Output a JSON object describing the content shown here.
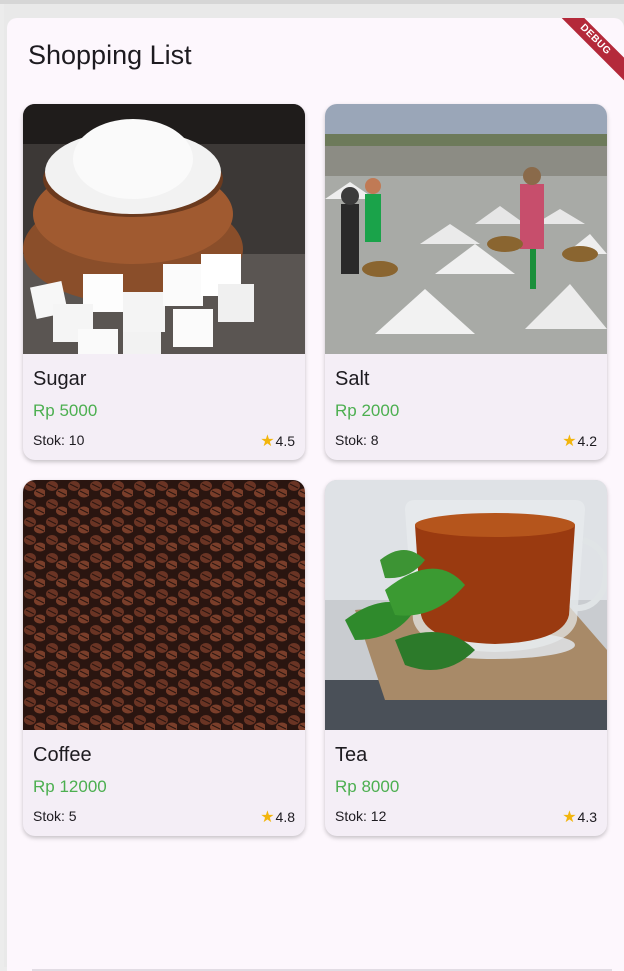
{
  "app": {
    "title": "Shopping List",
    "debug_banner": "DEBUG"
  },
  "items": [
    {
      "name": "Sugar",
      "price": "Rp 5000",
      "stock": "Stok: 10",
      "rating": "4.5",
      "image": "sugar-image"
    },
    {
      "name": "Salt",
      "price": "Rp 2000",
      "stock": "Stok: 8",
      "rating": "4.2",
      "image": "salt-image"
    },
    {
      "name": "Coffee",
      "price": "Rp 12000",
      "stock": "Stok: 5",
      "rating": "4.8",
      "image": "coffee-image"
    },
    {
      "name": "Tea",
      "price": "Rp 8000",
      "stock": "Stok: 12",
      "rating": "4.3",
      "image": "tea-image"
    }
  ],
  "colors": {
    "price": "#4caf50",
    "star": "#f2b50c",
    "background": "#fdf7fd",
    "card": "#f4eef6",
    "debug": "#b4293a"
  }
}
